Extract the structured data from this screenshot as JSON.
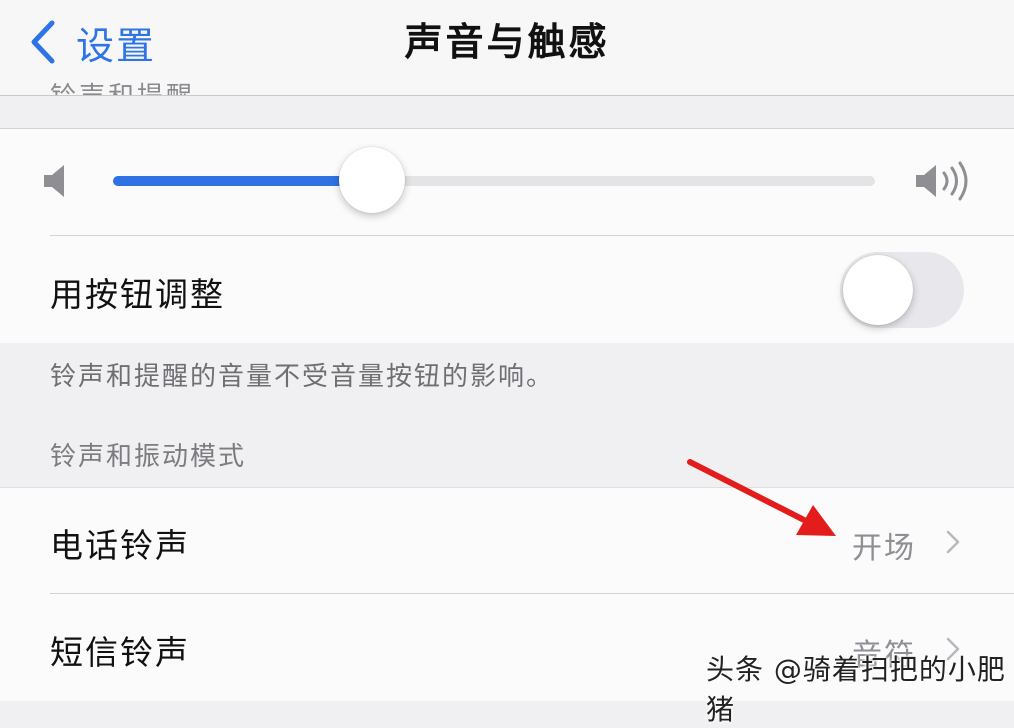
{
  "nav": {
    "back_label": "设置",
    "title": "声音与触感"
  },
  "ringtone_section": {
    "header_partial": "铃声和提醒",
    "volume_level_percent": 34,
    "change_with_buttons": {
      "label": "用按钮调整",
      "toggle_on": false
    },
    "footer": "铃声和提醒的音量不受音量按钮的影响。"
  },
  "mode_section": {
    "header": "铃声和振动模式",
    "rows": [
      {
        "label": "电话铃声",
        "value": "开场"
      },
      {
        "label": "短信铃声",
        "value": "音符"
      }
    ]
  },
  "watermark": "头条 @骑着扫把的小肥猪",
  "colors": {
    "accent": "#2f74e6",
    "annotation_arrow": "#e31c1c"
  },
  "icons": {
    "back": "chevron-left-icon",
    "volume_low": "speaker-low-icon",
    "volume_high": "speaker-high-icon",
    "disclosure": "chevron-right-icon"
  }
}
